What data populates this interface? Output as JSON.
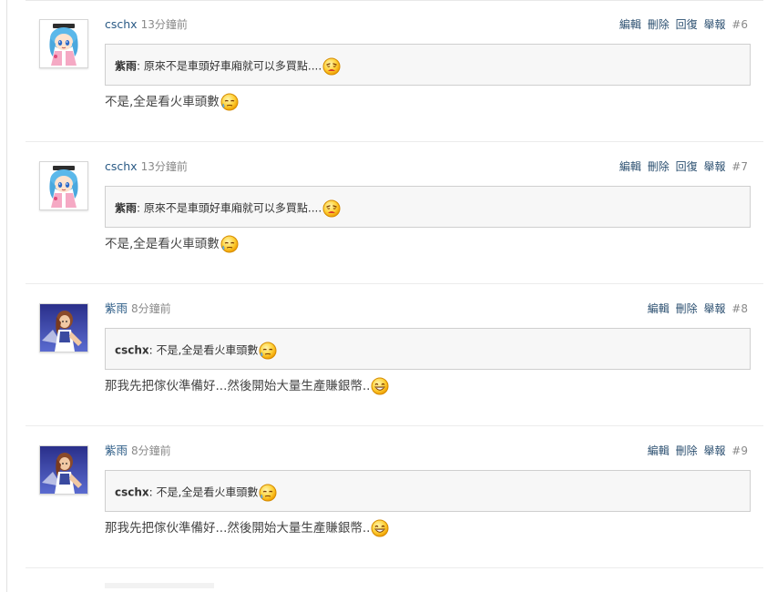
{
  "labels": {
    "edit": "編輯",
    "delete": "刪除",
    "reply": "回復",
    "report": "舉報"
  },
  "posts": [
    {
      "username": "cschx",
      "time": "13分鐘前",
      "number": "#6",
      "avatar_icon": "anime-girl-blue-hair-avatar",
      "show_reply": true,
      "quote_author": "紫雨",
      "quote_sep": ":",
      "quote_text": "原來不是車頭好車廂就可以多買點....",
      "quote_emoticon": "crying-face-emoticon",
      "body": "不是,全是看火車頭數",
      "body_emoticon": "sweat-face-emoticon"
    },
    {
      "username": "cschx",
      "time": "13分鐘前",
      "number": "#7",
      "avatar_icon": "anime-girl-blue-hair-avatar",
      "show_reply": true,
      "quote_author": "紫雨",
      "quote_sep": ":",
      "quote_text": "原來不是車頭好車廂就可以多買點....",
      "quote_emoticon": "crying-face-emoticon",
      "body": "不是,全是看火車頭數",
      "body_emoticon": "sweat-face-emoticon"
    },
    {
      "username": "紫雨",
      "time": "8分鐘前",
      "number": "#8",
      "avatar_icon": "fighter-girl-avatar",
      "show_reply": false,
      "quote_author": "cschx",
      "quote_sep": ":",
      "quote_text": "不是,全是看火車頭數",
      "quote_emoticon": "sweat-face-emoticon",
      "body": "那我先把傢伙準備好...然後開始大量生產賺銀幣..",
      "body_emoticon": "grinning-face-emoticon"
    },
    {
      "username": "紫雨",
      "time": "8分鐘前",
      "number": "#9",
      "avatar_icon": "fighter-girl-avatar",
      "show_reply": false,
      "quote_author": "cschx",
      "quote_sep": ":",
      "quote_text": "不是,全是看火車頭數",
      "quote_emoticon": "sweat-face-emoticon",
      "body": "那我先把傢伙準備好...然後開始大量生產賺銀幣..",
      "body_emoticon": "grinning-face-emoticon"
    }
  ]
}
